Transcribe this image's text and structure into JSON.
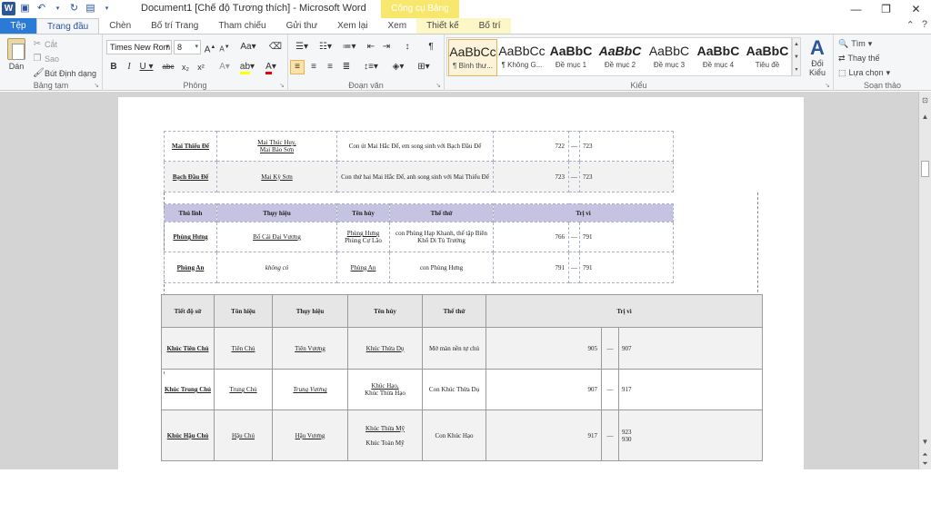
{
  "window": {
    "title": "Document1 [Chế độ Tương thích]  -  Microsoft Word",
    "context_header": "Công cụ Bảng"
  },
  "tabs": [
    "Tệp",
    "Trang đầu",
    "Chèn",
    "Bố trí Trang",
    "Tham chiếu",
    "Gửi thư",
    "Xem lại",
    "Xem",
    "Thiết kế",
    "Bố trí"
  ],
  "ribbon": {
    "clipboard": {
      "name": "Bảng tạm",
      "paste": "Dán",
      "cut": "Cắt",
      "copy": "Sao",
      "format_painter": "Bút Định dạng"
    },
    "font": {
      "name": "Phông",
      "family": "Times New Rom",
      "size": "8"
    },
    "paragraph": {
      "name": "Đoạn văn"
    },
    "styles": {
      "name": "Kiểu",
      "items": [
        {
          "preview": "AaBbCc",
          "label": "¶ Bình thư..."
        },
        {
          "preview": "AaBbCc",
          "label": "¶ Không G..."
        },
        {
          "preview": "AaBbC",
          "label": "Đề mục 1"
        },
        {
          "preview": "AaBbC",
          "label": "Đề mục 2"
        },
        {
          "preview": "AaBbC",
          "label": "Đề mục 3"
        },
        {
          "preview": "AaBbC",
          "label": "Đề mục 4"
        },
        {
          "preview": "AaBbC",
          "label": "Tiêu đề"
        }
      ],
      "change_styles": "Đổi Kiểu"
    },
    "editing": {
      "name": "Soạn thảo",
      "find": "Tìm",
      "replace": "Thay thế",
      "select": "Lựa chọn"
    }
  },
  "table1": {
    "rows": [
      {
        "name": "Mai Thiếu Đế",
        "title_line1": "Mai Thúc Huy,",
        "title_line2": "Mai Bảo Sơn",
        "desc": "Con út Mai Hắc Đế, em song sinh với Bạch Đầu Đế",
        "start": "722",
        "dash": "—",
        "end": "723"
      },
      {
        "name": "Bạch Đầu Đế",
        "title_line1": "Mai Kỳ Sơn",
        "title_line2": "",
        "desc": "Con thứ hai Mai Hắc Đế, anh song sinh với Mai Thiếu Đế",
        "start": "723",
        "dash": "—",
        "end": "723"
      }
    ]
  },
  "table2": {
    "headers": [
      "Thủ lĩnh",
      "Thụy hiệu",
      "Tên húy",
      "Thế thứ",
      "Trị vì"
    ],
    "rows": [
      {
        "name": "Phùng Hưng",
        "posthumous": "Bố Cái Đại Vương",
        "given_line1": "Phùng Hưng",
        "given_line2": "Phùng Cự Lão",
        "lineage": "con Phùng Hạp Khanh, thế tập Biên Khố Di Tù Trưởng",
        "start": "766",
        "dash": "—",
        "end": "791"
      },
      {
        "name": "Phùng An",
        "posthumous": "không có",
        "given_line1": "Phùng An",
        "given_line2": "",
        "lineage": "con Phùng Hưng",
        "start": "791",
        "dash": "—",
        "end": "791"
      }
    ]
  },
  "table3": {
    "headers": [
      "Tiết độ sứ",
      "Tôn hiệu",
      "Thụy hiệu",
      "Tên húy",
      "Thế thứ",
      "Trị vì"
    ],
    "rows": [
      {
        "name": "Khúc Tiên Chủ",
        "honor": "Tiên Chủ",
        "posthumous": "Tiên Vương",
        "given_line1": "Khúc Thừa Dụ",
        "given_line2": "",
        "lineage": "Mở màn nền tự chủ",
        "start": "905",
        "dash": "—",
        "end1": "907",
        "end2": ""
      },
      {
        "name": "Khúc Trung Chủ",
        "honor": "Trung Chủ",
        "posthumous": "Trung Vương",
        "given_line1": "Khúc Hạo,",
        "given_line2": "Khúc Thừa Hạo",
        "lineage": "Con Khúc Thừa Dụ",
        "start": "907",
        "dash": "—",
        "end1": "917",
        "end2": ""
      },
      {
        "name": "Khúc Hậu Chủ",
        "honor": "Hậu Chủ",
        "posthumous": "Hậu Vương",
        "given_line1": "Khúc Thừa Mỹ",
        "given_line2": "Khúc Toàn Mỹ",
        "lineage": "Con Khúc Hạo",
        "start": "917",
        "dash": "—",
        "end1": "923",
        "end2": "930"
      }
    ]
  }
}
